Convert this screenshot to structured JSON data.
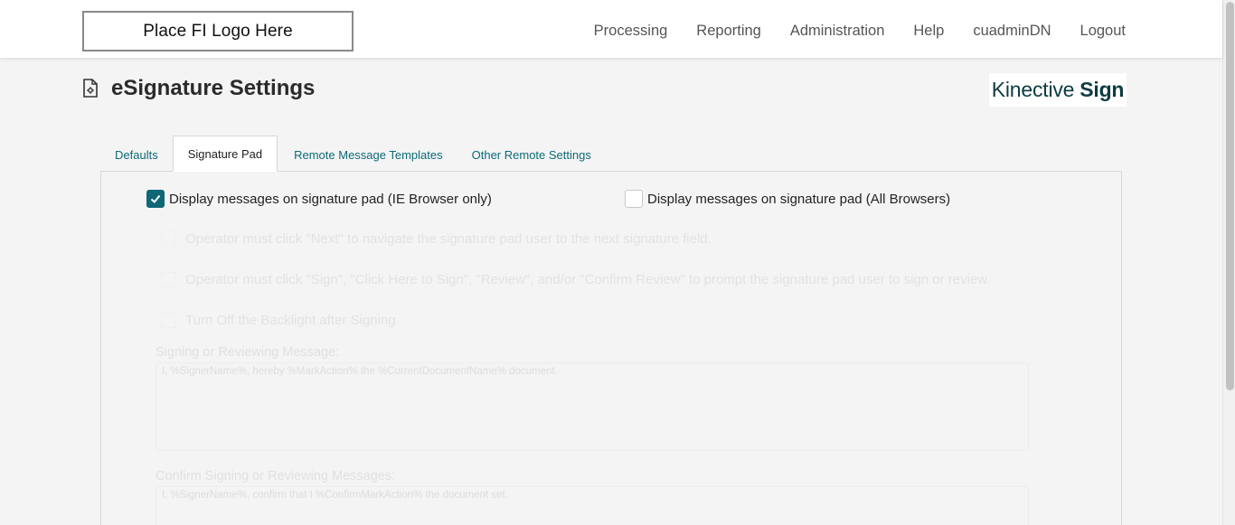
{
  "header": {
    "logo_text": "Place FI Logo Here",
    "nav": [
      "Processing",
      "Reporting",
      "Administration",
      "Help",
      "cuadminDN",
      "Logout"
    ]
  },
  "page": {
    "title": "eSignature Settings",
    "brand_light": "Kinective",
    "brand_bold": "Sign"
  },
  "tabs": [
    {
      "label": "Defaults",
      "active": false
    },
    {
      "label": "Signature Pad",
      "active": true
    },
    {
      "label": "Remote Message Templates",
      "active": false
    },
    {
      "label": "Other Remote Settings",
      "active": false
    }
  ],
  "signature_pad": {
    "ie_only_label": "Display messages on signature pad (IE Browser only)",
    "ie_only_checked": true,
    "all_browsers_label": "Display messages on signature pad (All Browsers)",
    "all_browsers_checked": false,
    "disabled_options": [
      "Operator must click \"Next\" to navigate the signature pad user to the next signature field.",
      "Operator must click \"Sign\", \"Click Here to Sign\", \"Review\", and/or \"Confirm Review\" to prompt the signature pad user to sign or review.",
      "Turn Off the Backlight after Signing"
    ],
    "signing_message_label": "Signing or Reviewing Message:",
    "signing_message_value": "I, %SignerName%, hereby %MarkAction% the %CurrentDocumentName% document.",
    "confirm_message_label": "Confirm Signing or Reviewing Messages:",
    "confirm_message_value": "I, %SignerName%, confirm that I %ConfirmMarkAction% the document set."
  },
  "colors": {
    "accent": "#0f6675",
    "tab_link": "#0b6b78",
    "brand": "#0e3b43"
  }
}
